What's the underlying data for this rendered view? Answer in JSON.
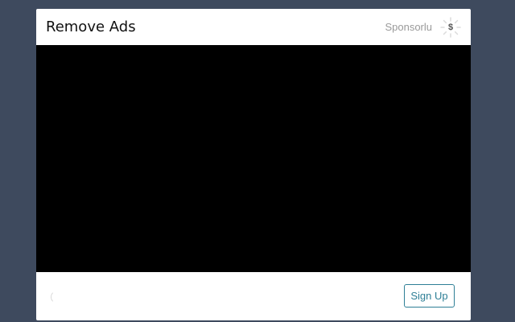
{
  "header": {
    "title": "Remove Ads",
    "sponsor_label": "Sponsorlu",
    "sponsor_icon": "dollar-badge-icon",
    "sponsor_icon_glyph": "$"
  },
  "video": {
    "background": "#000000"
  },
  "footer": {
    "loading_icon": "spinner-icon",
    "signup_label": "Sign Up",
    "accent_color": "#2e7f96"
  }
}
